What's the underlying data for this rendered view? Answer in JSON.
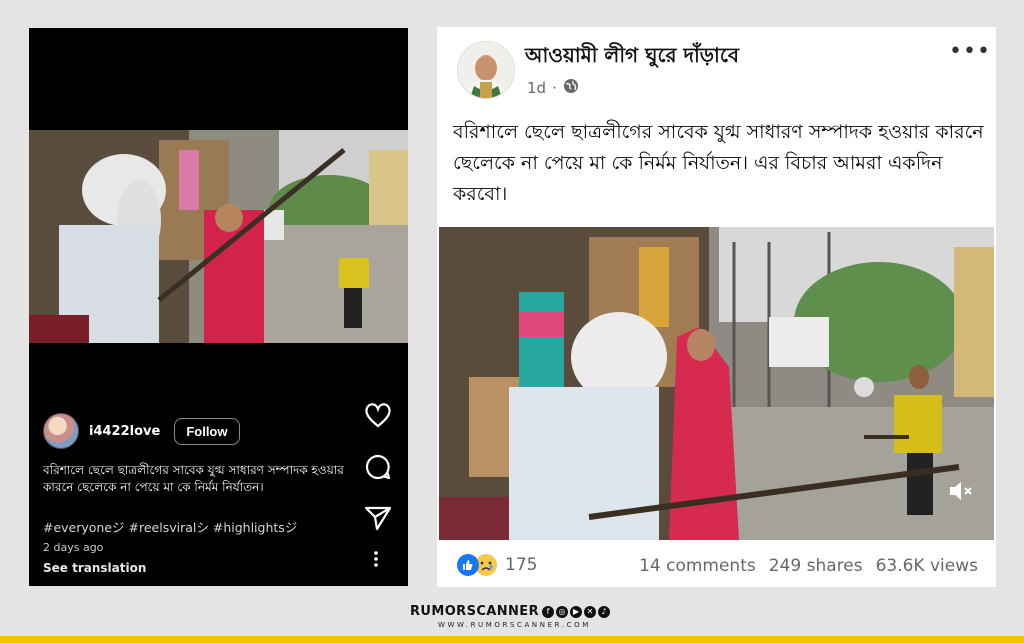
{
  "instagram": {
    "username": "i4422love",
    "follow_label": "Follow",
    "caption": "বরিশালে ছেলে ছাত্রলীগের সাবেক যুগ্ম সাধারণ সম্পাদক হওয়ার কারনে ছেলেকে না পেয়ে মা কে নির্মম নির্যাতন।",
    "hashtags": "#everyoneジ #reelsviralシ #highlightsジ",
    "time_ago": "2 days ago",
    "see_translation": "See translation",
    "icons": [
      "heart-icon",
      "comment-icon",
      "share-icon",
      "more-icon"
    ]
  },
  "facebook": {
    "page_name": "আওয়ামী লীগ ঘুরে দাঁড়াবে",
    "time": "1d",
    "more": "•••",
    "post_text": "বরিশালে ছেলে ছাত্রলীগের সাবেক যুগ্ম সাধারণ সম্পাদক হওয়ার কারনে ছেলেকে না পেয়ে মা কে নির্মম নির্যাতন। এর বিচার আমরা একদিন করবো।",
    "reaction_count": "175",
    "comments": "14 comments",
    "shares": "249 shares",
    "views": "63.6K views",
    "colors": {
      "like_blue": "#1877f2",
      "sad_yellow": "#f7c84b",
      "text_gray": "#65676b"
    }
  },
  "footer": {
    "brand": "RUMORSCANNER",
    "url": "WWW.RUMORSCANNER.COM",
    "bar_color": "#f5c400"
  }
}
